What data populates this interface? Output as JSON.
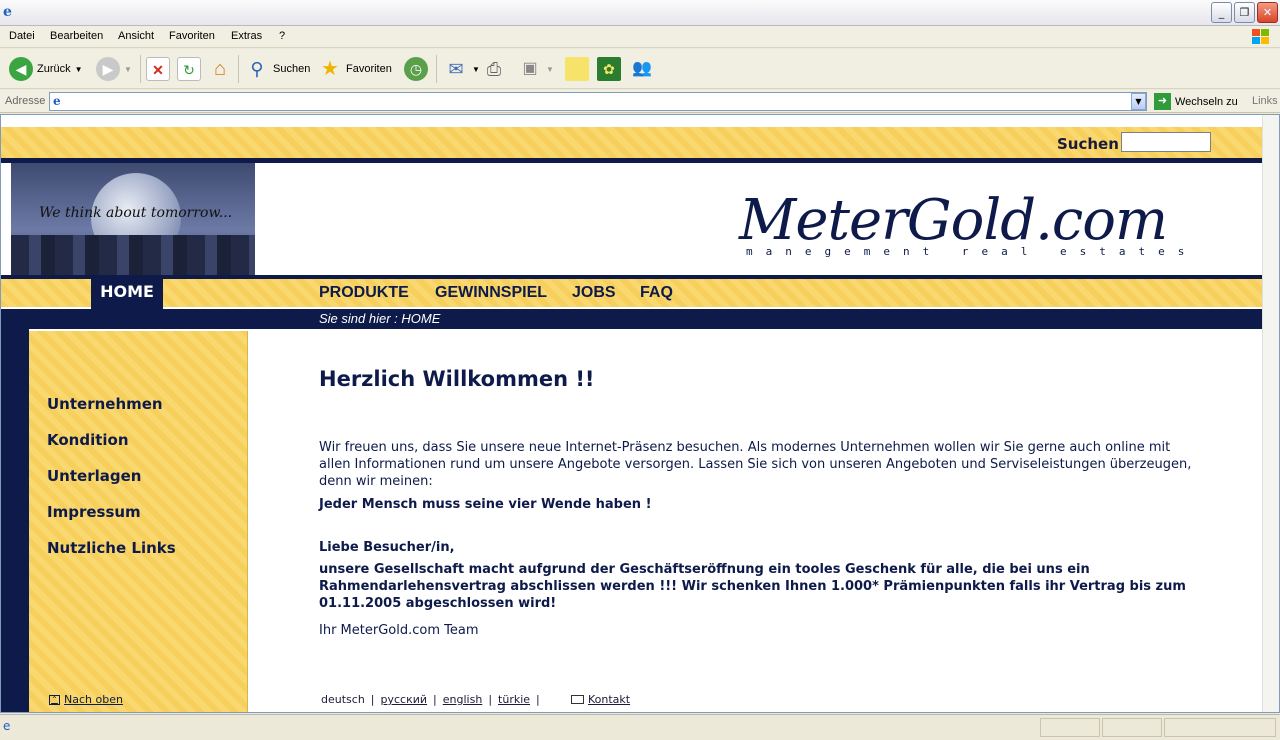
{
  "browser": {
    "menu": [
      "Datei",
      "Bearbeiten",
      "Ansicht",
      "Favoriten",
      "Extras",
      "?"
    ],
    "toolbar": {
      "back_label": "Zurück",
      "search_label": "Suchen",
      "favorites_label": "Favoriten"
    },
    "address": {
      "label": "Adresse",
      "value": "",
      "go_label": "Wechseln zu",
      "links_label": "Links"
    }
  },
  "page": {
    "search_label": "Suchen",
    "search_value": "",
    "banner_slogan": "We think about tomorrow...",
    "logo_text": "MeterGold.com",
    "logo_subtitle": "manegement real estates",
    "nav": {
      "home": "HOME",
      "links": [
        "PRODUKTE",
        "GEWINNSPIEL",
        "JOBS",
        "FAQ"
      ]
    },
    "breadcrumb": "Sie sind hier : HOME",
    "sidebar": {
      "items": [
        "Unternehmen",
        "Kondition",
        "Unterlagen",
        "Impressum",
        "Nutzliche Links"
      ],
      "back_to_top": "Nach oben"
    },
    "content": {
      "title": "Herzlich Willkommen !!",
      "intro": "Wir freuen uns, dass Sie unsere neue Internet-Präsenz besuchen. Als modernes Unternehmen wollen wir Sie gerne auch online mit allen Informationen rund um unsere Angebote versorgen. Lassen Sie sich von unseren Angeboten und Serviseleistungen überzeugen, denn wir meinen:",
      "motto": "Jeder Mensch muss seine vier Wende haben !",
      "greeting": "Liebe Besucher/in,",
      "announcement": "unsere Gesellschaft macht aufgrund der Geschäftseröffnung ein tooles Geschenk für alle, die bei uns ein Rahmendarlehensvertrag abschlissen werden !!! Wir schenken Ihnen 1.000* Prämienpunkten falls ihr Vertrag bis  zum  01.11.2005  abgeschlossen wird!",
      "signature": "Ihr MeterGold.com Team"
    },
    "footer": {
      "languages": [
        "deutsch",
        "русский",
        "english",
        "türkie"
      ],
      "contact": "Kontakt"
    }
  }
}
